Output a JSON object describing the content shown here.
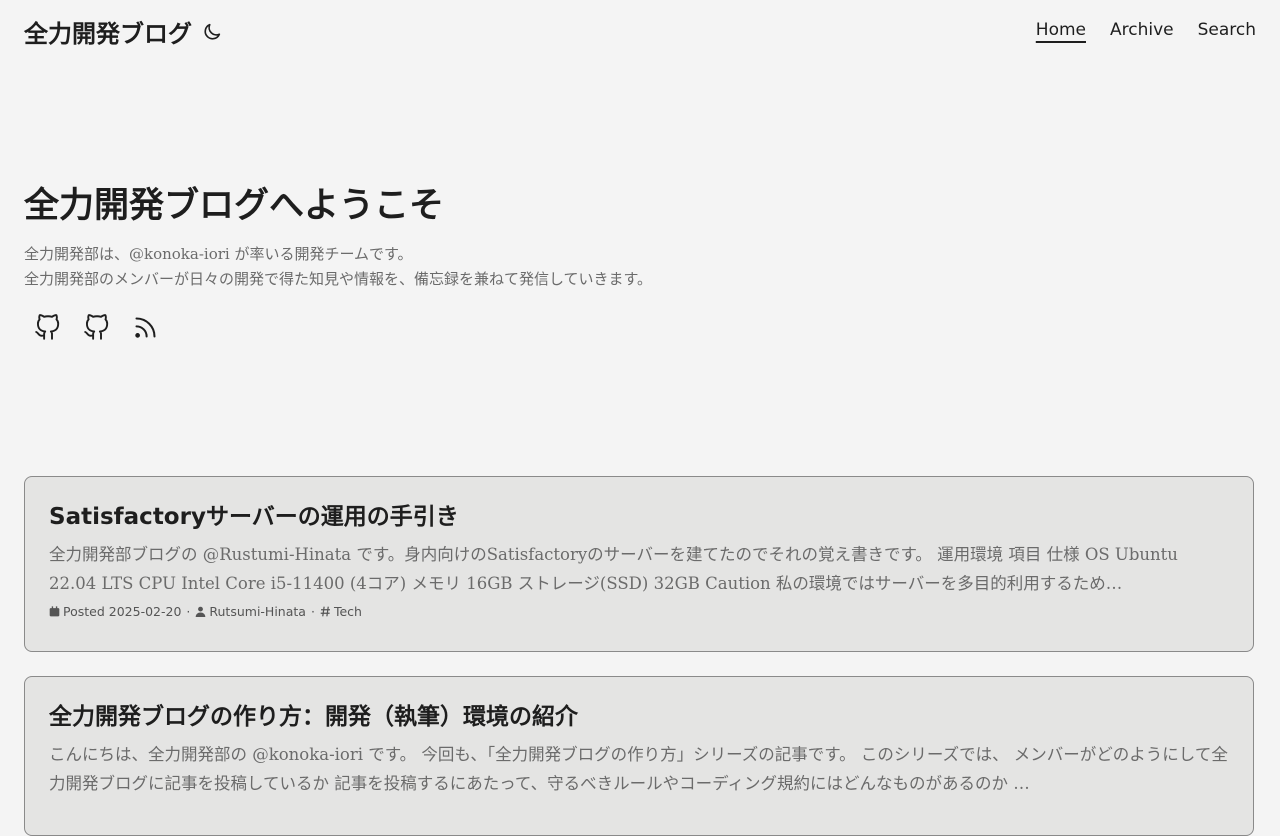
{
  "site": {
    "title": "全力開発ブログ",
    "theme_toggle_icon": "moon-icon"
  },
  "nav": {
    "items": [
      {
        "label": "Home",
        "active": true
      },
      {
        "label": "Archive",
        "active": false
      },
      {
        "label": "Search",
        "active": false
      }
    ]
  },
  "hero": {
    "title": "全力開発ブログへようこそ",
    "description_lines": [
      "全力開発部は、@konoka-iori が率いる開発チームです。",
      "全力開発部のメンバーが日々の開発で得た知見や情報を、備忘録を兼ねて発信していきます。"
    ],
    "social_icons": [
      "github-icon",
      "github-icon",
      "rss-icon"
    ]
  },
  "posts": [
    {
      "title": "Satisfactoryサーバーの運用の手引き",
      "excerpt": "全力開発部ブログの @Rustumi-Hinata です。身内向けのSatisfactoryのサーバーを建てたのでそれの覚え書きです。 運用環境 項目 仕様 OS Ubuntu 22.04 LTS CPU Intel Core i5-11400 (4コア) メモリ 16GB ストレージ(SSD) 32GB Caution 私の環境ではサーバーを多目的利用するため…",
      "meta": {
        "posted": "Posted 2025-02-20",
        "author": "Rutsumi-Hinata",
        "tag": "Tech"
      }
    },
    {
      "title": "全力開発ブログの作り方：開発（執筆）環境の紹介",
      "excerpt": "こんにちは、全力開発部の @konoka-iori です。 今回も、「全力開発ブログの作り方」シリーズの記事です。 このシリーズでは、 メンバーがどのようにして全力開発ブログに記事を投稿しているか 記事を投稿するにあたって、守るべきルールやコーディング規約にはどんなものがあるのか …",
      "meta": {
        "posted": "",
        "author": "",
        "tag": ""
      }
    }
  ],
  "colors": {
    "background": "#f4f4f4",
    "card_background": "#e4e4e3",
    "card_border": "#8a8a8a",
    "text_primary": "#1e1e1e",
    "text_secondary": "#6b6b6b"
  }
}
